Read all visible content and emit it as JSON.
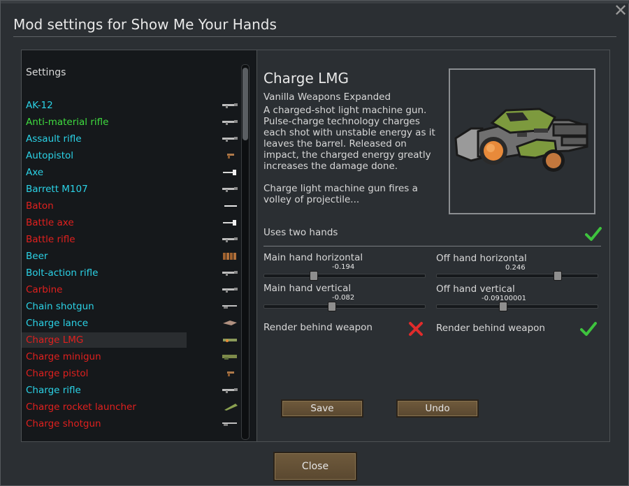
{
  "dialog": {
    "title": "Mod settings for Show Me Your Hands",
    "close_label": "Close"
  },
  "colors": {
    "cyan": "#2bd2e6",
    "green": "#3fdc3f",
    "red": "#e0201e",
    "check_green": "#3ec33e",
    "cross_red": "#e02b2b"
  },
  "list": {
    "header": "Settings",
    "items": [
      {
        "label": "AK-12",
        "color": "#2bd2e6",
        "icon": "rifle-icon"
      },
      {
        "label": "Anti-material rifle",
        "color": "#3fdc3f",
        "icon": "rifle-icon"
      },
      {
        "label": "Assault rifle",
        "color": "#2bd2e6",
        "icon": "rifle-icon"
      },
      {
        "label": "Autopistol",
        "color": "#2bd2e6",
        "icon": "pistol-icon"
      },
      {
        "label": "Axe",
        "color": "#2bd2e6",
        "icon": "axe-icon"
      },
      {
        "label": "Barrett M107",
        "color": "#2bd2e6",
        "icon": "rifle-icon"
      },
      {
        "label": "Baton",
        "color": "#e0201e",
        "icon": "baton-icon"
      },
      {
        "label": "Battle axe",
        "color": "#e0201e",
        "icon": "axe-icon"
      },
      {
        "label": "Battle rifle",
        "color": "#e0201e",
        "icon": "rifle-icon"
      },
      {
        "label": "Beer",
        "color": "#2bd2e6",
        "icon": "beer-icon"
      },
      {
        "label": "Bolt-action rifle",
        "color": "#2bd2e6",
        "icon": "rifle-icon"
      },
      {
        "label": "Carbine",
        "color": "#e0201e",
        "icon": "rifle-icon"
      },
      {
        "label": "Chain shotgun",
        "color": "#2bd2e6",
        "icon": "shotgun-icon"
      },
      {
        "label": "Charge lance",
        "color": "#2bd2e6",
        "icon": "lance-icon"
      },
      {
        "label": "Charge LMG",
        "color": "#e0201e",
        "icon": "lmg-icon",
        "selected": true
      },
      {
        "label": "Charge minigun",
        "color": "#e0201e",
        "icon": "minigun-icon"
      },
      {
        "label": "Charge pistol",
        "color": "#e0201e",
        "icon": "pistol-icon"
      },
      {
        "label": "Charge rifle",
        "color": "#2bd2e6",
        "icon": "rifle-icon"
      },
      {
        "label": "Charge rocket launcher",
        "color": "#e0201e",
        "icon": "launcher-icon"
      },
      {
        "label": "Charge shotgun",
        "color": "#e0201e",
        "icon": "shotgun-icon"
      }
    ]
  },
  "detail": {
    "title": "Charge LMG",
    "source": "Vanilla Weapons Expanded",
    "description": "A charged-shot light machine gun. Pulse-charge technology charges each shot with unstable energy as it leaves the barrel. Released on impact, the charged energy greatly increases the damage done.\n\nCharge light machine gun fires a volley of projectile...",
    "image_icon": "charge-lmg-icon",
    "uses_two_hands_label": "Uses two hands",
    "uses_two_hands": true,
    "main_h": {
      "label": "Main hand horizontal",
      "value_text": "-0.194",
      "value": -0.194
    },
    "off_h": {
      "label": "Off hand horizontal",
      "value_text": "0.246",
      "value": 0.246
    },
    "main_v": {
      "label": "Main hand vertical",
      "value_text": "-0.082",
      "value": -0.082
    },
    "off_v": {
      "label": "Off hand vertical",
      "value_text": "-0.09100001",
      "value": -0.09100001
    },
    "main_render_label": "Render behind weapon",
    "main_render": false,
    "off_render_label": "Render behind weapon",
    "off_render": true,
    "save_label": "Save",
    "undo_label": "Undo"
  }
}
